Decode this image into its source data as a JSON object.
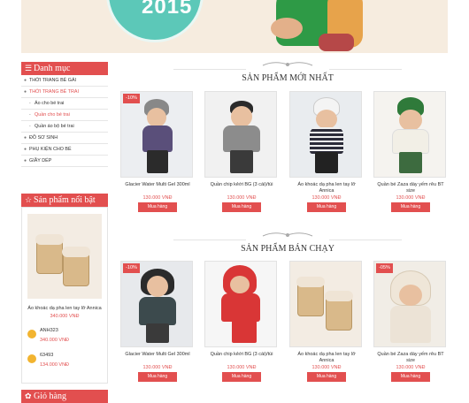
{
  "banner": {
    "year": "2015"
  },
  "sidebar": {
    "category_title": "Danh mục",
    "items": [
      {
        "label": "THỜI TRANG BÉ GÁI",
        "level": 0,
        "active": false
      },
      {
        "label": "THỜI TRANG BÉ TRAI",
        "level": 0,
        "active": true
      },
      {
        "label": "Áo cho bé trai",
        "level": 1,
        "active": false
      },
      {
        "label": "Quần cho bé trai",
        "level": 1,
        "active": true
      },
      {
        "label": "Quần áo bộ bé trai",
        "level": 1,
        "active": false
      },
      {
        "label": "ĐỒ SƠ SINH",
        "level": 0,
        "active": false
      },
      {
        "label": "PHỤ KIỆN CHO BÉ",
        "level": 0,
        "active": false
      },
      {
        "label": "GIẦY DÉP",
        "level": 0,
        "active": false
      }
    ],
    "featured_title": "Sản phẩm nổi bật",
    "featured": {
      "name": "Áo khoác dạ pha len tay lỡ Annica",
      "price": "340.000 VNĐ"
    },
    "mini": [
      {
        "name": "ANH323",
        "price": "340.000 VNĐ"
      },
      {
        "name": "63493",
        "price": "134.000 VNĐ"
      }
    ],
    "cart_title": "Giỏ hàng"
  },
  "sections": {
    "new_title": "SẢN PHẨM MỚI NHẤT",
    "best_title": "SẢN PHẨM BÁN CHẠY"
  },
  "buy_label": "Mua hàng",
  "new_products": [
    {
      "name": "Glacier Water Multi Gel 300ml",
      "price": "130.000 VNĐ",
      "badge": "-10%"
    },
    {
      "name": "Quần chip kẻới BG (3 cái)/túi",
      "price": "130.000 VNĐ",
      "badge": ""
    },
    {
      "name": "Áo khoác dạ pha len tay lỡ Annica",
      "price": "130.000 VNĐ",
      "badge": ""
    },
    {
      "name": "Quần bé Zaza dày yếm rêu BT size",
      "price": "130.000 VNĐ",
      "badge": ""
    }
  ],
  "best_products": [
    {
      "name": "Glacier Water Multi Gel 300ml",
      "price": "130.000 VNĐ",
      "badge": "-10%"
    },
    {
      "name": "Quần chip kẻới BG (3 cái)/túi",
      "price": "130.000 VNĐ",
      "badge": ""
    },
    {
      "name": "Áo khoác dạ pha len tay lỡ Annica",
      "price": "130.000 VNĐ",
      "badge": ""
    },
    {
      "name": "Quần bé Zaza dày yếm rêu BT size",
      "price": "130.000 VNĐ",
      "badge": "-05%"
    }
  ],
  "colors": {
    "accent": "#e24f4f",
    "banner_teal": "#5cc8b8"
  }
}
